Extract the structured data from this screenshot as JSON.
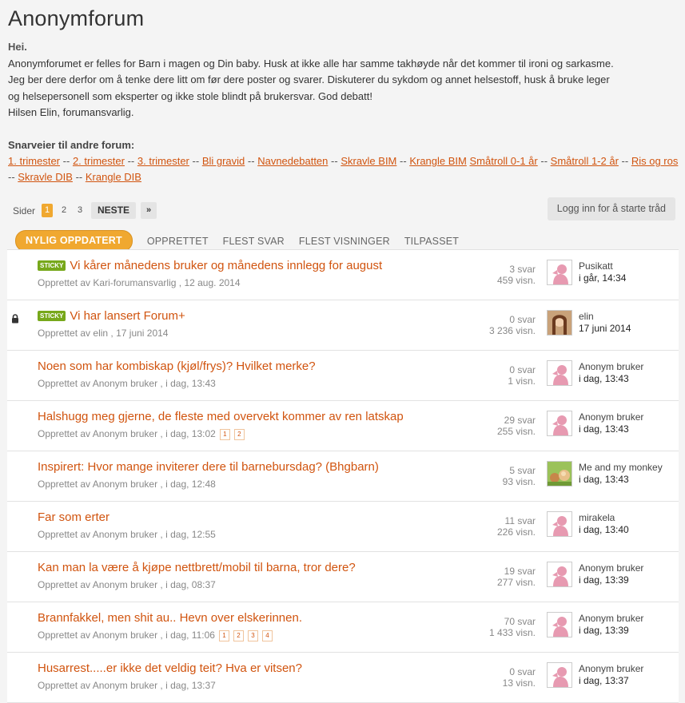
{
  "title": "Anonymforum",
  "intro": {
    "greeting": "Hei.",
    "line1": "Anonymforumet er felles for Barn i magen og Din baby. Husk at ikke alle har samme takhøyde når det kommer til ironi og sarkasme.",
    "line2": "Jeg ber dere derfor om å tenke dere litt om før dere poster og svarer. Diskuterer du sykdom og annet helsestoff, husk å bruke leger",
    "line3": "og helsepersonell som eksperter og ikke stole blindt på brukersvar. God debatt!",
    "line4": "Hilsen Elin, forumansvarlig."
  },
  "shortcuts": {
    "label": "Snarveier til andre forum:",
    "links": [
      "1. trimester",
      "2. trimester",
      "3. trimester",
      "Bli gravid",
      "Navnedebatten",
      "Skravle BIM",
      "Krangle BIM",
      "Småtroll 0-1 år",
      "Småtroll 1-2 år",
      "Ris og ros",
      "Skravle DIB",
      "Krangle DIB"
    ],
    "separator": "--"
  },
  "pager": {
    "label": "Sider",
    "pages": [
      "1",
      "2",
      "3"
    ],
    "next": "NESTE",
    "last": "»"
  },
  "login_button": "Logg inn for å starte tråd",
  "tabs": [
    "NYLIG OPPDATERT",
    "OPPRETTET",
    "FLEST SVAR",
    "FLEST VISNINGER",
    "TILPASSET"
  ],
  "sticky_label": "STICKY",
  "created_prefix": "Opprettet av",
  "threads": [
    {
      "subject": "Vi kårer månedens bruker og månedens innlegg for august",
      "author": "Kari-forumansvarlig",
      "date": "12 aug. 2014",
      "replies": "3 svar",
      "views": "459 visn.",
      "last_user": "Pusikatt",
      "last_time": "i går, 14:34"
    },
    {
      "subject": "Vi har lansert Forum+",
      "author": "elin",
      "date": "17 juni 2014",
      "replies": "0 svar",
      "views": "3 236 visn.",
      "last_user": "elin",
      "last_time": "17 juni 2014"
    },
    {
      "subject": "Noen som har kombiskap (kjøl/frys)? Hvilket merke?",
      "author": "Anonym bruker",
      "date": "i dag, 13:43",
      "replies": "0 svar",
      "views": "1 visn.",
      "last_user": "Anonym bruker",
      "last_time": "i dag, 13:43"
    },
    {
      "subject": "Halshugg meg gjerne, de fleste med overvekt kommer av ren latskap",
      "author": "Anonym bruker",
      "date": "i dag, 13:02",
      "pages": [
        "1",
        "2"
      ],
      "replies": "29 svar",
      "views": "255 visn.",
      "last_user": "Anonym bruker",
      "last_time": "i dag, 13:43"
    },
    {
      "subject": "Inspirert: Hvor mange inviterer dere til barnebursdag? (Bhgbarn)",
      "author": "Anonym bruker",
      "date": "i dag, 12:48",
      "replies": "5 svar",
      "views": "93 visn.",
      "last_user": "Me and my monkey",
      "last_time": "i dag, 13:43"
    },
    {
      "subject": "Far som erter",
      "author": "Anonym bruker",
      "date": "i dag, 12:55",
      "replies": "11 svar",
      "views": "226 visn.",
      "last_user": "mirakela",
      "last_time": "i dag, 13:40"
    },
    {
      "subject": "Kan man la være å kjøpe nettbrett/mobil til barna, tror dere?",
      "author": "Anonym bruker",
      "date": "i dag, 08:37",
      "replies": "19 svar",
      "views": "277 visn.",
      "last_user": "Anonym bruker",
      "last_time": "i dag, 13:39"
    },
    {
      "subject": "Brannfakkel, men shit au.. Hevn over elskerinnen.",
      "author": "Anonym bruker",
      "date": "i dag, 11:06",
      "pages": [
        "1",
        "2",
        "3",
        "4"
      ],
      "replies": "70 svar",
      "views": "1 433 visn.",
      "last_user": "Anonym bruker",
      "last_time": "i dag, 13:39"
    },
    {
      "subject": "Husarrest.....er ikke det veldig teit? Hva er vitsen?",
      "author": "Anonym bruker",
      "date": "i dag, 13:37",
      "replies": "0 svar",
      "views": "13 visn.",
      "last_user": "Anonym bruker",
      "last_time": "i dag, 13:37"
    }
  ],
  "colors": {
    "accent": "#f0a830",
    "link": "#d1540f",
    "sticky": "#77a81b",
    "avatar_pink": "#e79ab1"
  }
}
